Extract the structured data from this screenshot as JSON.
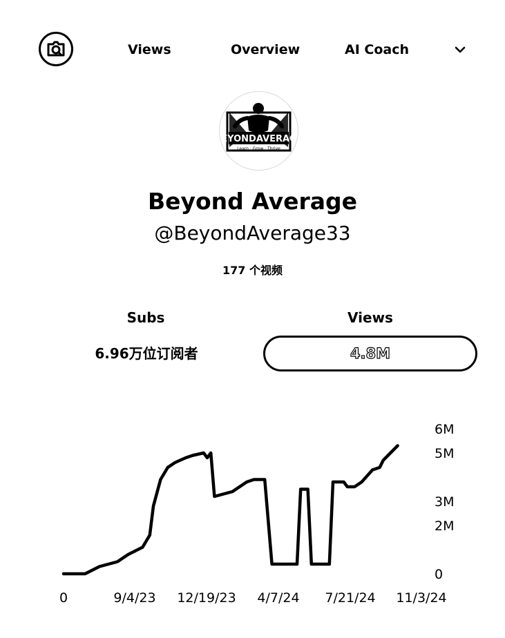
{
  "nav": {
    "tabs": [
      {
        "label": "Views"
      },
      {
        "label": "Overview"
      },
      {
        "label": "AI Coach"
      }
    ],
    "logo_icon": "camera-search-icon",
    "menu_icon": "chevron-down-icon"
  },
  "channel": {
    "name": "Beyond Average",
    "handle": "@BeyondAverage33",
    "video_count": "177 个视频",
    "avatar": {
      "icon": "muscle-man-logo",
      "logo_text": "BEYONDAVERAGE",
      "logo_tagline": "Learn · Grow · Thrive"
    }
  },
  "stats": {
    "subs_label": "Subs",
    "subs_value": "6.96万位订阅者",
    "views_label": "Views",
    "views_value": "4.8M"
  },
  "chart_data": {
    "type": "line",
    "title": "",
    "xlabel": "",
    "ylabel": "",
    "x_tick_labels": [
      "0",
      "9/4/23",
      "12/19/23",
      "4/7/24",
      "7/21/24",
      "11/3/24"
    ],
    "y_tick_labels": [
      "0",
      "2M",
      "3M",
      "5M",
      "6M"
    ],
    "y_tick_values": [
      0,
      2000000,
      3000000,
      5000000,
      6000000
    ],
    "ylim": [
      0,
      6000000
    ],
    "grid": false,
    "legend": "none",
    "y_axis_position": "right",
    "series": [
      {
        "values": [
          [
            0.0,
            0
          ],
          [
            0.06,
            0
          ],
          [
            0.1,
            300000
          ],
          [
            0.15,
            500000
          ],
          [
            0.18,
            800000
          ],
          [
            0.22,
            1100000
          ],
          [
            0.24,
            1600000
          ],
          [
            0.25,
            2800000
          ],
          [
            0.27,
            3900000
          ],
          [
            0.29,
            4400000
          ],
          [
            0.31,
            4600000
          ],
          [
            0.34,
            4800000
          ],
          [
            0.36,
            4900000
          ],
          [
            0.39,
            5000000
          ],
          [
            0.4,
            4800000
          ],
          [
            0.41,
            5000000
          ],
          [
            0.42,
            3200000
          ],
          [
            0.47,
            3400000
          ],
          [
            0.51,
            3800000
          ],
          [
            0.53,
            3900000
          ],
          [
            0.56,
            3900000
          ],
          [
            0.58,
            400000
          ],
          [
            0.65,
            400000
          ],
          [
            0.66,
            3500000
          ],
          [
            0.68,
            3500000
          ],
          [
            0.69,
            400000
          ],
          [
            0.74,
            400000
          ],
          [
            0.75,
            3800000
          ],
          [
            0.78,
            3800000
          ],
          [
            0.79,
            3600000
          ],
          [
            0.81,
            3600000
          ],
          [
            0.83,
            3800000
          ],
          [
            0.86,
            4300000
          ],
          [
            0.88,
            4400000
          ],
          [
            0.89,
            4700000
          ],
          [
            0.91,
            5000000
          ],
          [
            0.93,
            5300000
          ]
        ]
      }
    ]
  },
  "colors": {
    "foreground": "#000000",
    "background": "#ffffff"
  }
}
